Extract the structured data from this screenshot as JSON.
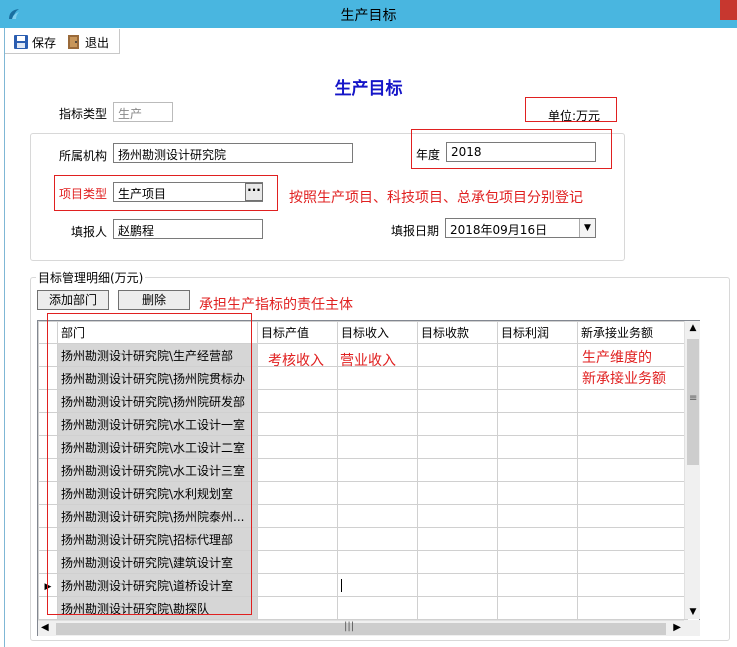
{
  "window": {
    "title": "生产目标"
  },
  "toolbar": {
    "save_label": "保存",
    "exit_label": "退出"
  },
  "form": {
    "title": "生产目标",
    "indicator_type_label": "指标类型",
    "indicator_type_value": "生产",
    "unit_label": "单位:万元",
    "org_label": "所属机构",
    "org_value": "扬州勘测设计研究院",
    "year_label": "年度",
    "year_value": "2018",
    "project_type_label": "项目类型",
    "project_type_value": "生产项目",
    "reporter_label": "填报人",
    "reporter_value": "赵鹏程",
    "report_date_label": "填报日期",
    "report_date_value": "2018年09月16日"
  },
  "annotations": {
    "project_type_note": "按照生产项目、科技项目、总承包项目分别登记",
    "dept_note": "承担生产指标的责任主体",
    "output_note": "考核收入",
    "income_note": "营业收入",
    "new_business_note_1": "生产维度的",
    "new_business_note_2": "新承接业务额"
  },
  "detail": {
    "group_label": "目标管理明细(万元)",
    "add_dept_label": "添加部门",
    "delete_label": "删除",
    "columns": [
      "部门",
      "目标产值",
      "目标收入",
      "目标收款",
      "目标利润",
      "新承接业务额"
    ],
    "rows": [
      "扬州勘测设计研究院\\生产经营部",
      "扬州勘测设计研究院\\扬州院贯标办",
      "扬州勘测设计研究院\\扬州院研发部",
      "扬州勘测设计研究院\\水工设计一室",
      "扬州勘测设计研究院\\水工设计二室",
      "扬州勘测设计研究院\\水工设计三室",
      "扬州勘测设计研究院\\水利规划室",
      "扬州勘测设计研究院\\扬州院泰州...",
      "扬州勘测设计研究院\\招标代理部",
      "扬州勘测设计研究院\\建筑设计室",
      "扬州勘测设计研究院\\道桥设计室",
      "扬州勘测设计研究院\\勘探队"
    ],
    "current_row_index": 10
  },
  "colors": {
    "titlebar": "#49b6e0",
    "annotation": "#e02020",
    "heading": "#1515c8"
  }
}
